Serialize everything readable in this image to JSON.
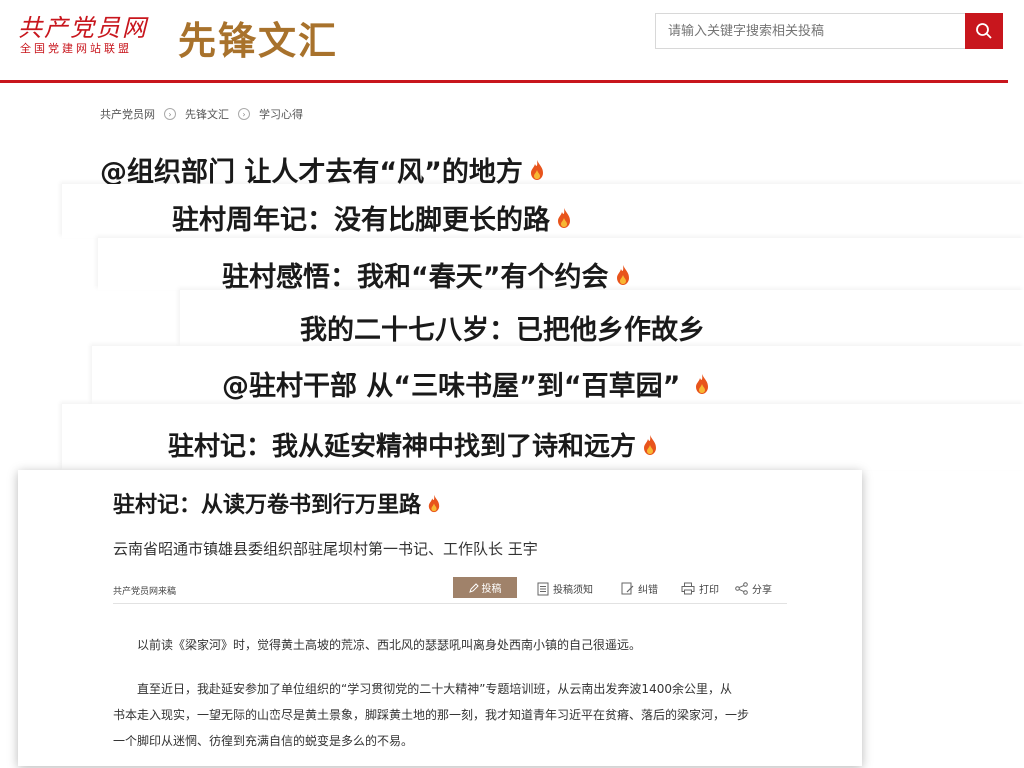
{
  "header": {
    "logo_script": "共产党员网",
    "logo_sub": "全国党建网站联盟",
    "section": "先锋文汇",
    "search_placeholder": "请输入关键字搜索相关投稿"
  },
  "breadcrumb": [
    "共产党员网",
    "先锋文汇",
    "学习心得"
  ],
  "headlines": [
    "@组织部门 让人才去有“风”的地方",
    "驻村周年记：没有比脚更长的路",
    "驻村感悟：我和“春天”有个约会",
    "我的二十七八岁：已把他乡作故乡",
    "@驻村干部 从“三味书屋”到“百草园”",
    "驻村记：我从延安精神中找到了诗和远方"
  ],
  "article": {
    "title": "驻村记：从读万卷书到行万里路",
    "subtitle": "云南省昭通市镇雄县委组织部驻尾坝村第一书记、工作队长 王宇",
    "source": "共产党员网来稿",
    "actions": {
      "submit": "投稿",
      "notice": "投稿须知",
      "correct": "纠错",
      "print": "打印",
      "share": "分享"
    },
    "paragraphs": [
      "以前读《梁家河》时，觉得黄土高坡的荒凉、西北风的瑟瑟吼叫离身处西南小镇的自己很遥远。",
      "直至近日，我赴延安参加了单位组织的“学习贯彻党的二十大精神”专题培训班，从云南出发奔波1400余公里，从",
      "书本走入现实，一望无际的山峦尽是黄土景象，脚踩黄土地的那一刻，我才知道青年习近平在贫瘠、落后的梁家河，一步",
      "一个脚印从迷惘、彷徨到充满自信的蜕变是多么的不易。"
    ]
  },
  "colors": {
    "brand_red": "#c8161d",
    "brand_gold": "#a8722c",
    "flame": "#e8541c"
  }
}
